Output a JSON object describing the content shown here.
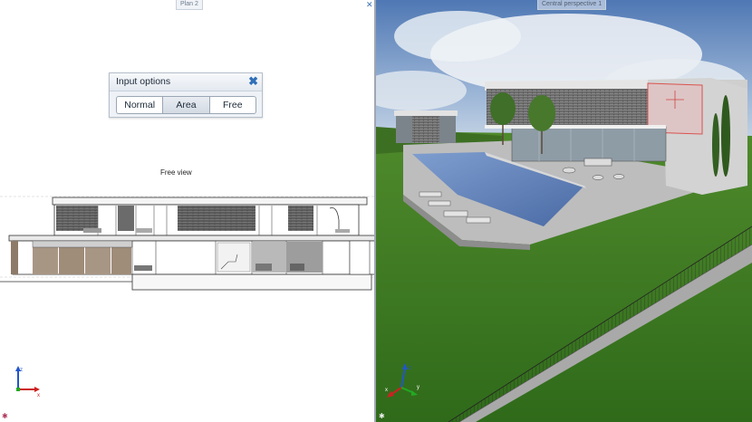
{
  "left_view": {
    "title": "Plan 2",
    "label": "Free view"
  },
  "right_view": {
    "title": "Central perspective 1"
  },
  "input_options": {
    "title": "Input options",
    "modes": [
      "Normal",
      "Area",
      "Free"
    ],
    "selected": "Area"
  },
  "icons": {
    "close": "close-icon",
    "axis_gizmo": "xyz-axis-icon",
    "navigation": "navigation-icon"
  },
  "colors": {
    "dialog_close": "#2f6fb8",
    "sky": "#6e94c6",
    "lawn": "#3f7b25",
    "pool": "#5c7fb8"
  }
}
